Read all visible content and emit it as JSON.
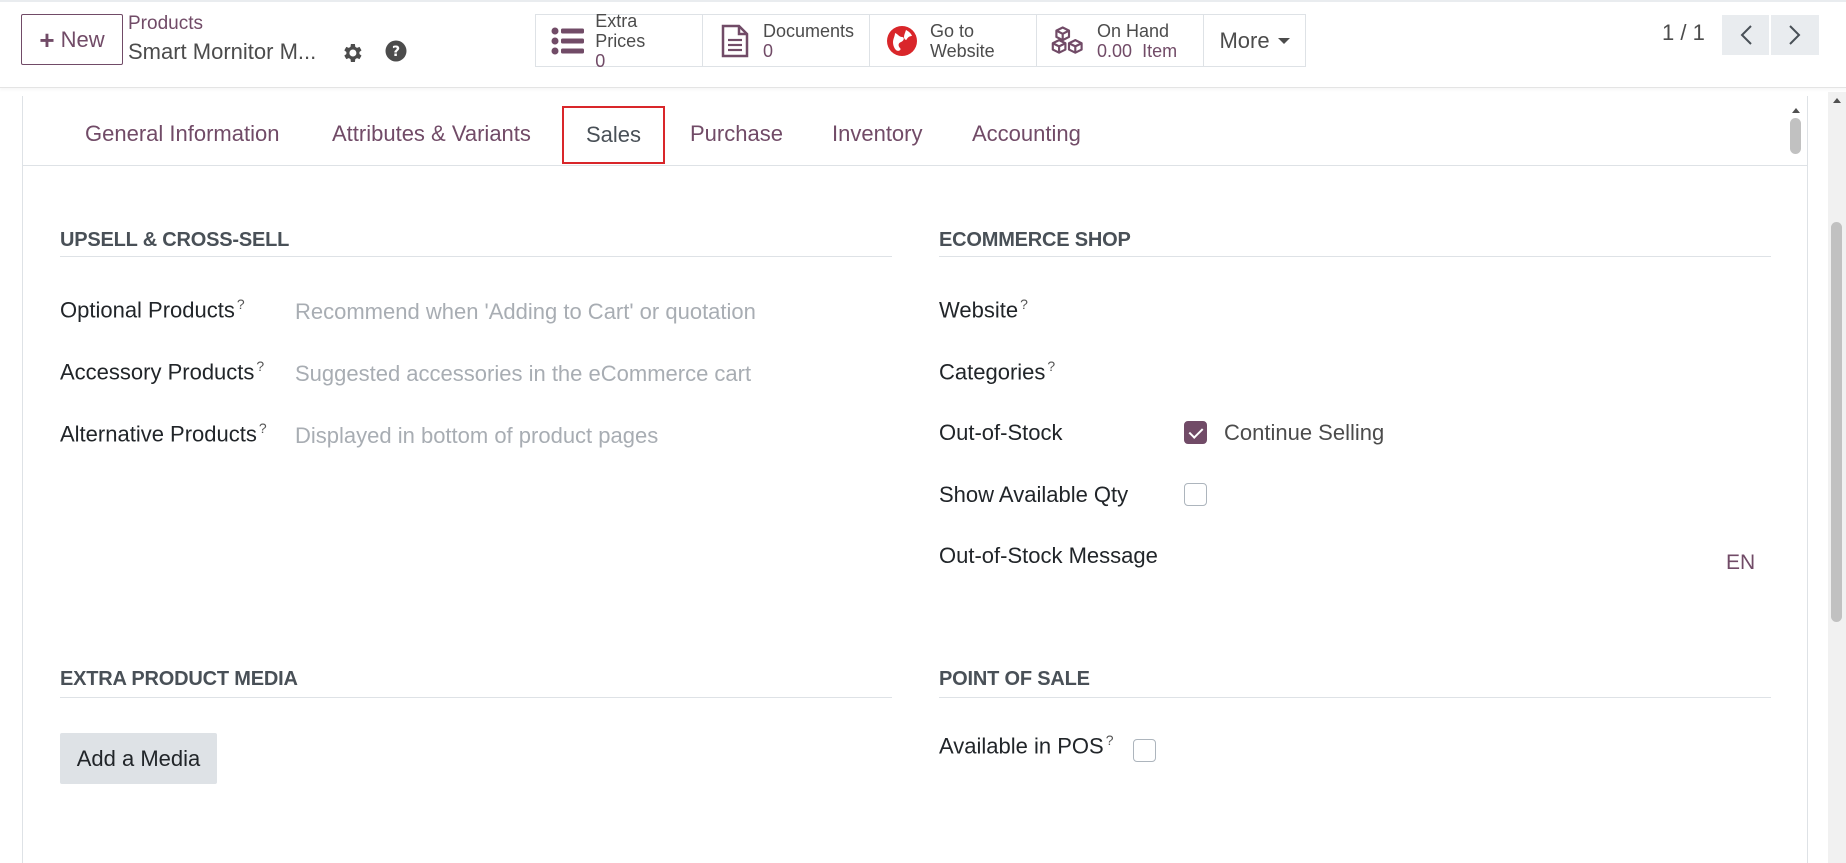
{
  "header": {
    "new_label": "New",
    "breadcrumb": "Products",
    "record_name": "Smart Mornitor M...",
    "icons": {
      "new": "plus-icon",
      "settings": "gear-icon",
      "help": "question-circle-icon"
    }
  },
  "smart_buttons": {
    "extra_prices": {
      "label": "Extra Prices",
      "value": "0",
      "icon": "list-icon"
    },
    "documents": {
      "label": "Documents",
      "value": "0",
      "icon": "file-text-icon"
    },
    "website": {
      "label_line1": "Go to",
      "label_line2": "Website",
      "icon": "globe-icon"
    },
    "on_hand": {
      "label": "On Hand",
      "value": "0.00",
      "unit": "Item",
      "icon": "cubes-icon"
    },
    "more": {
      "label": "More"
    }
  },
  "pager": {
    "value": "1 / 1"
  },
  "tabs": [
    {
      "label": "General Information"
    },
    {
      "label": "Attributes & Variants"
    },
    {
      "label": "Sales",
      "active": true
    },
    {
      "label": "Purchase"
    },
    {
      "label": "Inventory"
    },
    {
      "label": "Accounting"
    }
  ],
  "upsell": {
    "title": "UPSELL & CROSS-SELL",
    "optional": {
      "label": "Optional Products",
      "help": "?",
      "placeholder": "Recommend when 'Adding to Cart' or quotation"
    },
    "accessory": {
      "label": "Accessory Products",
      "help": "?",
      "placeholder": "Suggested accessories in the eCommerce cart"
    },
    "alternative": {
      "label": "Alternative Products",
      "help": "?",
      "placeholder": "Displayed in bottom of product pages"
    }
  },
  "ecommerce": {
    "title": "ECOMMERCE SHOP",
    "website": {
      "label": "Website",
      "help": "?"
    },
    "categories": {
      "label": "Categories",
      "help": "?"
    },
    "out_of_stock": {
      "label": "Out-of-Stock",
      "option": "Continue Selling",
      "checked": true
    },
    "show_qty": {
      "label": "Show Available Qty",
      "checked": false
    },
    "oos_message": {
      "label": "Out-of-Stock Message",
      "lang": "EN"
    }
  },
  "media": {
    "title": "EXTRA PRODUCT MEDIA",
    "add_label": "Add a Media"
  },
  "pos": {
    "title": "POINT OF SALE",
    "available": {
      "label": "Available in POS",
      "help": "?",
      "checked": false
    }
  },
  "colors": {
    "accent": "#714B67",
    "highlight": "#d9262a"
  }
}
